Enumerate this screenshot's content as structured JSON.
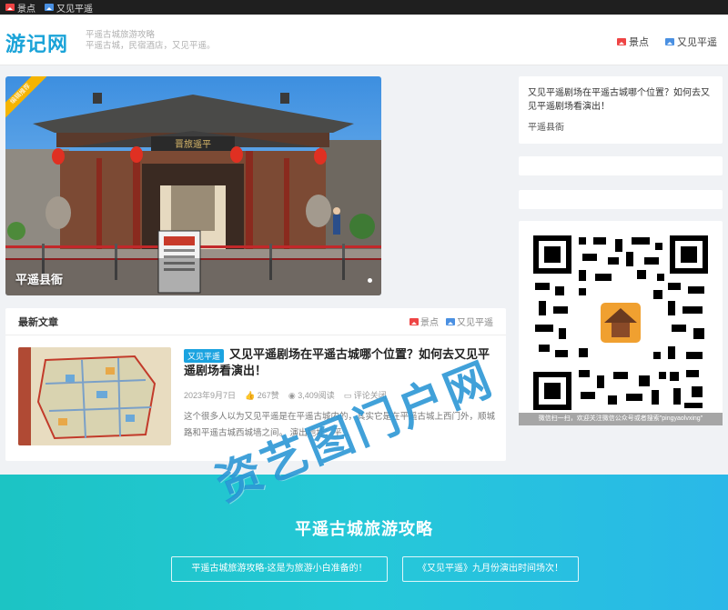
{
  "topbar": {
    "items": [
      {
        "label": "景点",
        "icon": "image-icon-red"
      },
      {
        "label": "又见平遥",
        "icon": "image-icon-blue"
      }
    ]
  },
  "header": {
    "logo": "游记网",
    "tagline_line1": "平遥古城旅游攻略",
    "tagline_line2": "平遥古城，民宿酒店，又见平遥。",
    "nav": [
      {
        "label": "景点"
      },
      {
        "label": "又见平遥"
      }
    ]
  },
  "hero": {
    "ribbon": "编辑推荐",
    "caption": "平遥县衙",
    "gate_sign": "晋旅遥平"
  },
  "latest": {
    "title": "最新文章",
    "links": [
      {
        "label": "景点"
      },
      {
        "label": "又见平遥"
      }
    ],
    "post": {
      "tag": "又见平遥",
      "title": "又见平遥剧场在平遥古城哪个位置？如何去又见平遥剧场看演出！",
      "date": "2023年9月7日",
      "likes": "267赞",
      "views": "3,409阅读",
      "comments": "评论关闭",
      "excerpt": "这个很多人以为又见平遥是在平遥古城内的，其实它是在平遥古城上西门外，顺城路和平遥古城西城墙之间。 演出地址：平..."
    }
  },
  "sidebar": {
    "question": "又见平遥剧场在平遥古城哪个位置？如何去又见平遥剧场看演出！",
    "answer": "平遥县衙",
    "qr_caption": "微信扫一扫，欢迎关注微信公众号或者搜索\"pingyaolvxing\""
  },
  "footer": {
    "title": "平遥古城旅游攻略",
    "buttons": [
      {
        "label": "平遥古城旅游攻略-这是为旅游小白准备的！"
      },
      {
        "label": "《又见平遥》九月份演出时间场次！"
      }
    ]
  },
  "watermark": "资艺图门户网",
  "colors": {
    "brand": "#1aa3d8",
    "tag": "#1ba3e0",
    "ribbon": "#f5b400",
    "footer_gradient_start": "#1cc4c4",
    "footer_gradient_end": "#2ab8e8"
  }
}
